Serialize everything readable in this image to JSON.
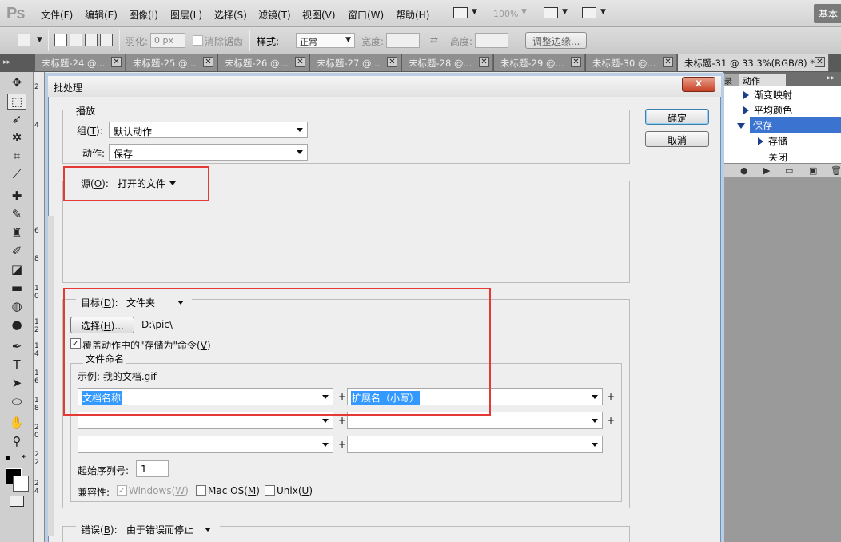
{
  "app": {
    "logo": "Ps",
    "menu": [
      "文件(F)",
      "编辑(E)",
      "图像(I)",
      "图层(L)",
      "选择(S)",
      "滤镜(T)",
      "视图(V)",
      "窗口(W)",
      "帮助(H)"
    ],
    "zoom": "100%",
    "workspace": "基本"
  },
  "options": {
    "feather_label": "羽化:",
    "feather_value": "0 px",
    "antialias_label": "消除锯齿",
    "style_label": "样式:",
    "style_value": "正常",
    "width_label": "宽度:",
    "height_label": "高度:",
    "refine_label": "调整边缘..."
  },
  "tabs": [
    {
      "label": "未标题-24 @..."
    },
    {
      "label": "未标题-25 @..."
    },
    {
      "label": "未标题-26 @..."
    },
    {
      "label": "未标题-27 @..."
    },
    {
      "label": "未标题-28 @..."
    },
    {
      "label": "未标题-29 @..."
    },
    {
      "label": "未标题-30 @..."
    },
    {
      "label": "未标题-31 @ 33.3%(RGB/8) *"
    }
  ],
  "ruler_v": [
    "2",
    "4",
    "6",
    "8",
    "1 0",
    "1 2",
    "1 4",
    "1 6",
    "1 8",
    "2 0",
    "2 2",
    "2 4"
  ],
  "panel": {
    "tab_left": "录",
    "tab": "动作",
    "menu": "▸▸",
    "actions": [
      {
        "label": "渐变映射"
      },
      {
        "label": "平均颜色"
      },
      {
        "label": "保存"
      },
      {
        "label": "存储"
      },
      {
        "label": "关闭"
      }
    ]
  },
  "dialog": {
    "title": "批处理",
    "close": "x",
    "ok": "确定",
    "cancel": "取消",
    "play": {
      "title": "播放",
      "group_label": "组(",
      "group_key": "T",
      "group_end": "):",
      "group_value": "默认动作",
      "action_label": "动作:",
      "action_value": "保存"
    },
    "source": {
      "label": "源(",
      "key": "O",
      "end": "):",
      "value": "打开的文件"
    },
    "dest": {
      "label": "目标(",
      "key": "D",
      "end": "):",
      "value": "文件夹",
      "choose": "选择(",
      "choose_key": "H",
      "choose_end": ")...",
      "path": "D:\\pic\\",
      "override": "覆盖动作中的\"存储为\"命令(",
      "override_key": "V",
      "override_end": ")"
    },
    "naming": {
      "title": "文件命名",
      "example": "示例: 我的文档.gif",
      "field1": "文档名称",
      "field2": "扩展名（小写）",
      "plus": "+",
      "serial_label": "起始序列号:",
      "serial_value": "1",
      "compat_label": "兼容性:",
      "windows": "Windows(",
      "windows_key": "W",
      "mac": "Mac OS(",
      "mac_key": "M",
      "unix": "Unix(",
      "unix_key": "U",
      "close_paren": ")"
    },
    "error": {
      "label": "错误(",
      "key": "B",
      "end": "):",
      "value": "由于错误而停止"
    }
  }
}
